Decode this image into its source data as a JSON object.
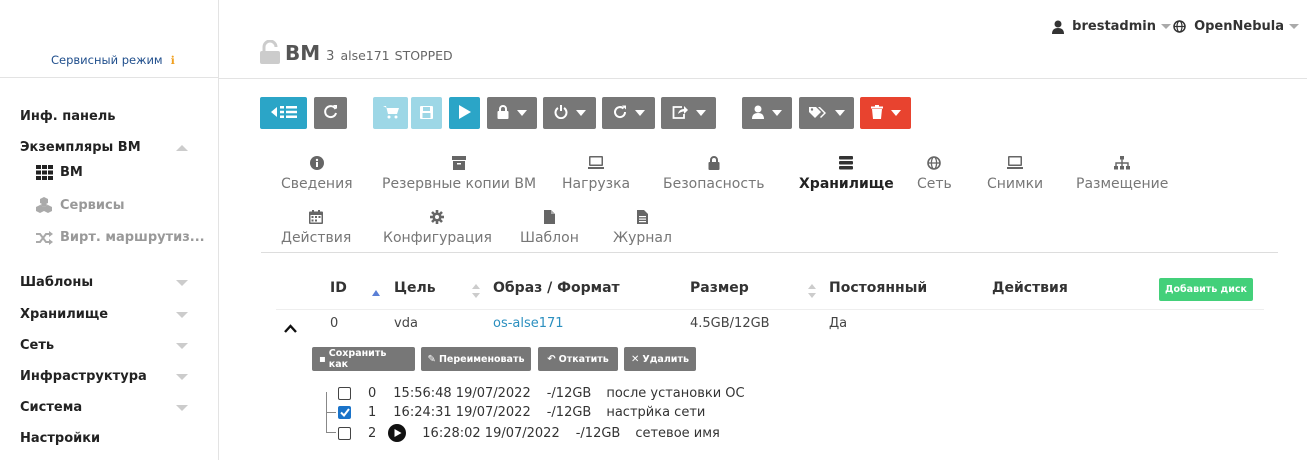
{
  "sidebar": {
    "mode_label": "Сервисный режим",
    "mode_icon": "info-icon",
    "items": [
      {
        "label": "Инф. панель"
      },
      {
        "label": "Экземпляры ВМ"
      },
      {
        "label": "Шаблоны"
      },
      {
        "label": "Хранилище"
      },
      {
        "label": "Сеть"
      },
      {
        "label": "Инфраструктура"
      },
      {
        "label": "Система"
      },
      {
        "label": "Настройки"
      }
    ],
    "subitems": [
      {
        "label": "ВМ",
        "icon": "grid-icon",
        "active": true
      },
      {
        "label": "Сервисы",
        "icon": "cubes-icon",
        "active": false
      },
      {
        "label": "Вирт. маршрутиз...",
        "icon": "random-icon",
        "active": false
      }
    ]
  },
  "header": {
    "title": "ВМ",
    "vm_id": "3",
    "vm_name": "alse171",
    "vm_state": "STOPPED",
    "user": "brestadmin",
    "zone": "OpenNebula"
  },
  "tabs": [
    {
      "label": "Сведения",
      "icon": "info-circle-icon"
    },
    {
      "label": "Резервные копии ВМ",
      "icon": "archive-icon"
    },
    {
      "label": "Нагрузка",
      "icon": "monitor-icon"
    },
    {
      "label": "Безопасность",
      "icon": "lock-icon"
    },
    {
      "label": "Хранилище",
      "icon": "database-icon",
      "active": true
    },
    {
      "label": "Сеть",
      "icon": "globe-icon"
    },
    {
      "label": "Снимки",
      "icon": "laptop-icon"
    },
    {
      "label": "Размещение",
      "icon": "sitemap-icon"
    },
    {
      "label": "Действия",
      "icon": "calendar-icon"
    },
    {
      "label": "Конфигурация",
      "icon": "cog-icon"
    },
    {
      "label": "Шаблон",
      "icon": "file-icon"
    },
    {
      "label": "Журнал",
      "icon": "file-text-icon"
    }
  ],
  "table": {
    "headers": [
      "ID",
      "Цель",
      "Образ / Формат",
      "Размер",
      "Постоянный",
      "Действия"
    ],
    "add_disk_label": "Добавить диск",
    "row": {
      "id": "0",
      "target": "vda",
      "image": "os-alse171",
      "size": "4.5GB/12GB",
      "persistent": "Да"
    },
    "snapshot_actions": [
      "Сохранить как",
      "Переименовать",
      "Откатить",
      "Удалить"
    ],
    "snapshots": [
      {
        "id": "0",
        "date": "15:56:48 19/07/2022",
        "size": "-/12GB",
        "name": "после установки ОС",
        "checked": false,
        "active": false
      },
      {
        "id": "1",
        "date": "16:24:31 19/07/2022",
        "size": "-/12GB",
        "name": "настрйка сети",
        "checked": true,
        "active": false
      },
      {
        "id": "2",
        "date": "16:28:02 19/07/2022",
        "size": "-/12GB",
        "name": "сетевое имя",
        "checked": false,
        "active": true
      }
    ]
  },
  "colors": {
    "teal": "#2ba5c7",
    "gray": "#777777",
    "red": "#e8432f",
    "green": "#43d07a",
    "link": "#2b8fbf"
  }
}
